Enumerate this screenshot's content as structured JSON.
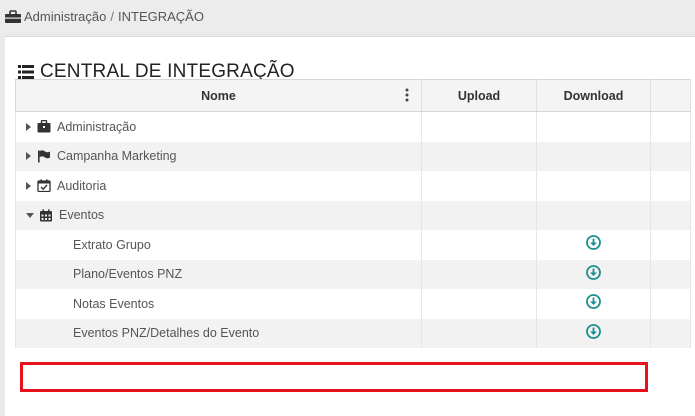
{
  "breadcrumb": {
    "icon": "briefcase-icon",
    "section": "Administração",
    "separator": "/",
    "page": "INTEGRAÇÃO"
  },
  "page_title": {
    "icon": "list-icon",
    "text": "CENTRAL DE INTEGRAÇÃO"
  },
  "grid": {
    "columns": {
      "name": "Nome",
      "upload": "Upload",
      "download": "Download"
    },
    "rows": [
      {
        "label": "Administração",
        "icon": "briefcase-icon",
        "expanded": false
      },
      {
        "label": "Campanha Marketing",
        "icon": "flag-icon",
        "expanded": false
      },
      {
        "label": "Auditoria",
        "icon": "calendar-check-icon",
        "expanded": false
      },
      {
        "label": "Eventos",
        "icon": "calendar-icon",
        "expanded": true
      },
      {
        "label": "Extrato Grupo",
        "download_icon": "download-circle-icon"
      },
      {
        "label": "Plano/Eventos PNZ",
        "download_icon": "download-circle-icon"
      },
      {
        "label": "Notas Eventos",
        "download_icon": "download-circle-icon"
      },
      {
        "label": "Eventos PNZ/Detalhes do Evento",
        "download_icon": "download-circle-icon"
      }
    ]
  },
  "colors": {
    "accent": "#1b8f8f",
    "highlight": "#e5121b",
    "row_alt": "#f2f2f2"
  }
}
